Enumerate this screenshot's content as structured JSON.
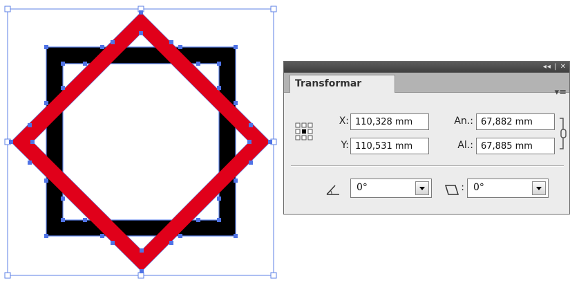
{
  "artwork": {
    "description_free": true,
    "colors": {
      "red_band": "#e0001a",
      "black_band": "#000000",
      "selection": "#5b7fe6",
      "anchor_point": "#4f73e6"
    }
  },
  "panel": {
    "titlebar_controls": "◂◂ | ✕",
    "tab_label": "Transformar",
    "menu_icon": "panel-menu-icon",
    "x_label": "X:",
    "x_value": "110,328 mm",
    "y_label": "Y:",
    "y_value": "110,531 mm",
    "width_label": "An.:",
    "width_value": "67,882 mm",
    "height_label": "Al.:",
    "height_value": "67,885 mm",
    "rotate_value": "0°",
    "shear_value": "0°"
  }
}
